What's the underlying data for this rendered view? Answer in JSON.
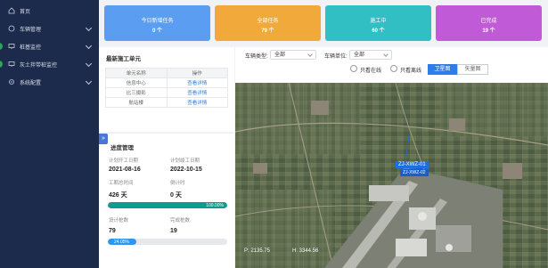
{
  "sidebar": {
    "items": [
      {
        "label": "首页",
        "icon": "home-icon"
      },
      {
        "label": "车辆管理",
        "icon": "car-icon"
      },
      {
        "label": "桩基监控",
        "icon": "monitor-icon"
      },
      {
        "label": "灰土拌带桩监控",
        "icon": "monitor-icon"
      },
      {
        "label": "系统配置",
        "icon": "settings-icon"
      }
    ]
  },
  "cards": [
    {
      "title": "今日新增任务",
      "value": "0 个",
      "color": "#5b9df0"
    },
    {
      "title": "全部任务",
      "value": "79 个",
      "color": "#f0a93a"
    },
    {
      "title": "施工中",
      "value": "60 个",
      "color": "#31bfc4"
    },
    {
      "title": "已完成",
      "value": "19 个",
      "color": "#c05ad6"
    }
  ],
  "units_panel": {
    "title": "最新施工单元",
    "columns": [
      "单元名称",
      "操作"
    ],
    "rows": [
      {
        "name": "信息中心",
        "action": "查看详情"
      },
      {
        "name": "比三摄影",
        "action": "查看详情"
      },
      {
        "name": "航站楼",
        "action": "查看详情"
      }
    ]
  },
  "progress_panel": {
    "title": "进度管理",
    "plan_start_label": "计划开工日期",
    "plan_start": "2021-08-16",
    "plan_end_label": "计划竣工日期",
    "plan_end": "2022-10-15",
    "total_days_label": "工期总时间",
    "total_days": "426 天",
    "remaining_label": "倒计时",
    "remaining": "0 天",
    "time_percent": "100.00%",
    "time_fraction": 1.0,
    "design_piles_label": "设计桩数",
    "design_piles": "79",
    "done_piles_label": "完成桩数",
    "done_piles": "19",
    "pile_percent": "24.05%",
    "pile_fraction": 0.2405
  },
  "filters": {
    "vehicle_type_label": "车辆类型:",
    "vehicle_type_value": "全部",
    "vehicle_unit_label": "车辆单位:",
    "vehicle_unit_value": "全部",
    "online_only": "只看在线",
    "offline_only": "只看离线",
    "satellite": "卫星图",
    "vector": "矢量图"
  },
  "map": {
    "marker_label": "ZJ-XWZ-01",
    "marker_sub": "ZJ-XWZ-02",
    "coord_p": "P: 2135.75",
    "coord_h": "H: 3344.56"
  }
}
